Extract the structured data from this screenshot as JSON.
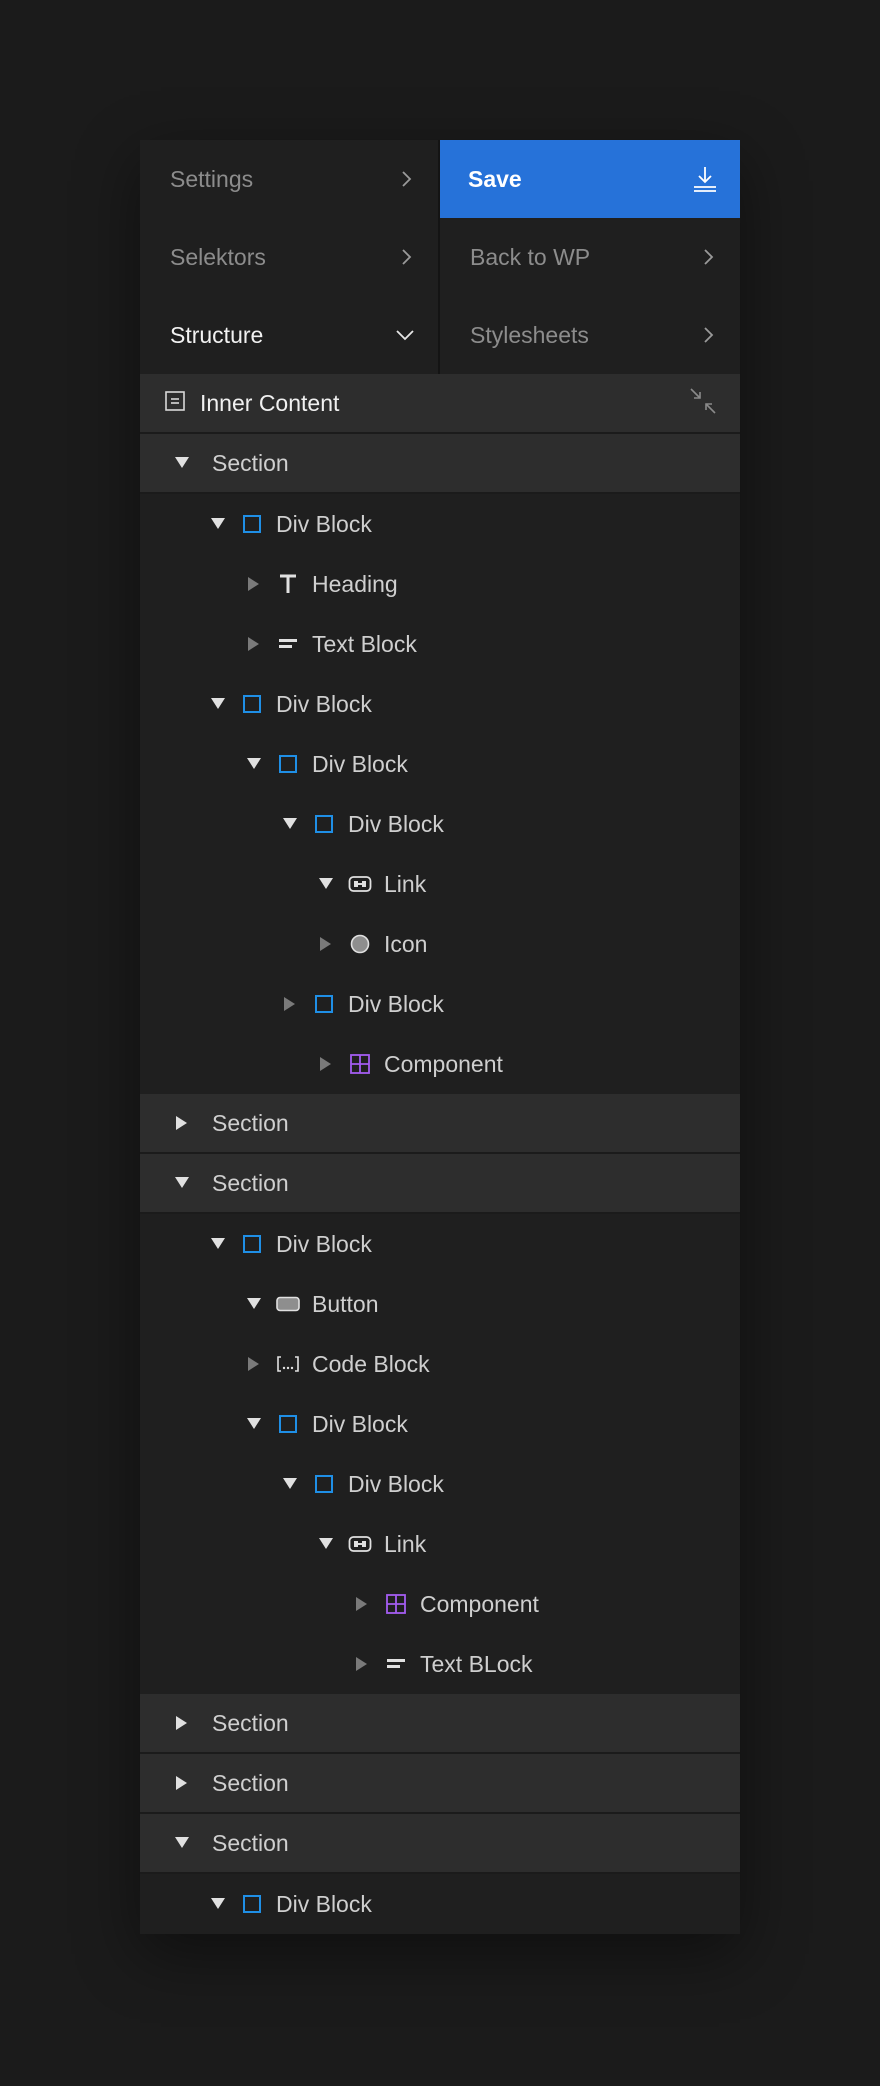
{
  "menu": {
    "left": [
      {
        "label": "Settings",
        "state": "collapsed"
      },
      {
        "label": "Selektors",
        "state": "collapsed"
      },
      {
        "label": "Structure",
        "state": "expanded"
      }
    ],
    "right": [
      {
        "label": "Save",
        "icon": "download-icon"
      },
      {
        "label": "Back to WP",
        "state": "collapsed"
      },
      {
        "label": "Stylesheets",
        "state": "collapsed"
      }
    ]
  },
  "inner_content": {
    "title": "Inner Content",
    "icon": "document-icon",
    "action_icon": "collapse-icon"
  },
  "colors": {
    "accent": "#2672d9",
    "div_block": "#1f8fe6",
    "component": "#a35cf0",
    "panel": "#1f1f1f",
    "section_row": "#2d2d2d"
  },
  "tree": [
    {
      "type": "section",
      "label": "Section",
      "depth": 0,
      "expanded": true
    },
    {
      "type": "div",
      "label": "Div Block",
      "depth": 1,
      "expanded": true
    },
    {
      "type": "heading",
      "label": "Heading",
      "depth": 2,
      "expanded": false
    },
    {
      "type": "text",
      "label": "Text Block",
      "depth": 2,
      "expanded": false
    },
    {
      "type": "div",
      "label": "Div Block",
      "depth": 1,
      "expanded": true
    },
    {
      "type": "div",
      "label": "Div Block",
      "depth": 2,
      "expanded": true
    },
    {
      "type": "div",
      "label": "Div Block",
      "depth": 3,
      "expanded": true
    },
    {
      "type": "link",
      "label": "Link",
      "depth": 4,
      "expanded": true
    },
    {
      "type": "icon",
      "label": "Icon",
      "depth": 4,
      "expanded": false
    },
    {
      "type": "div",
      "label": "Div Block",
      "depth": 3,
      "expanded": false
    },
    {
      "type": "component",
      "label": "Component",
      "depth": 4,
      "expanded": false
    },
    {
      "type": "section",
      "label": "Section",
      "depth": 0,
      "expanded": false
    },
    {
      "type": "section",
      "label": "Section",
      "depth": 0,
      "expanded": true
    },
    {
      "type": "div",
      "label": "Div Block",
      "depth": 1,
      "expanded": true
    },
    {
      "type": "button",
      "label": "Button",
      "depth": 2,
      "expanded": true
    },
    {
      "type": "code",
      "label": "Code Block",
      "depth": 2,
      "expanded": false
    },
    {
      "type": "div",
      "label": "Div Block",
      "depth": 2,
      "expanded": true
    },
    {
      "type": "div",
      "label": "Div Block",
      "depth": 3,
      "expanded": true
    },
    {
      "type": "link",
      "label": "Link",
      "depth": 4,
      "expanded": true
    },
    {
      "type": "component",
      "label": "Component",
      "depth": 5,
      "expanded": false
    },
    {
      "type": "text",
      "label": "Text BLock",
      "depth": 5,
      "expanded": false
    },
    {
      "type": "section",
      "label": "Section",
      "depth": 0,
      "expanded": false
    },
    {
      "type": "section",
      "label": "Section",
      "depth": 0,
      "expanded": false
    },
    {
      "type": "section",
      "label": "Section",
      "depth": 0,
      "expanded": true
    },
    {
      "type": "div",
      "label": "Div Block",
      "depth": 1,
      "expanded": true
    }
  ]
}
